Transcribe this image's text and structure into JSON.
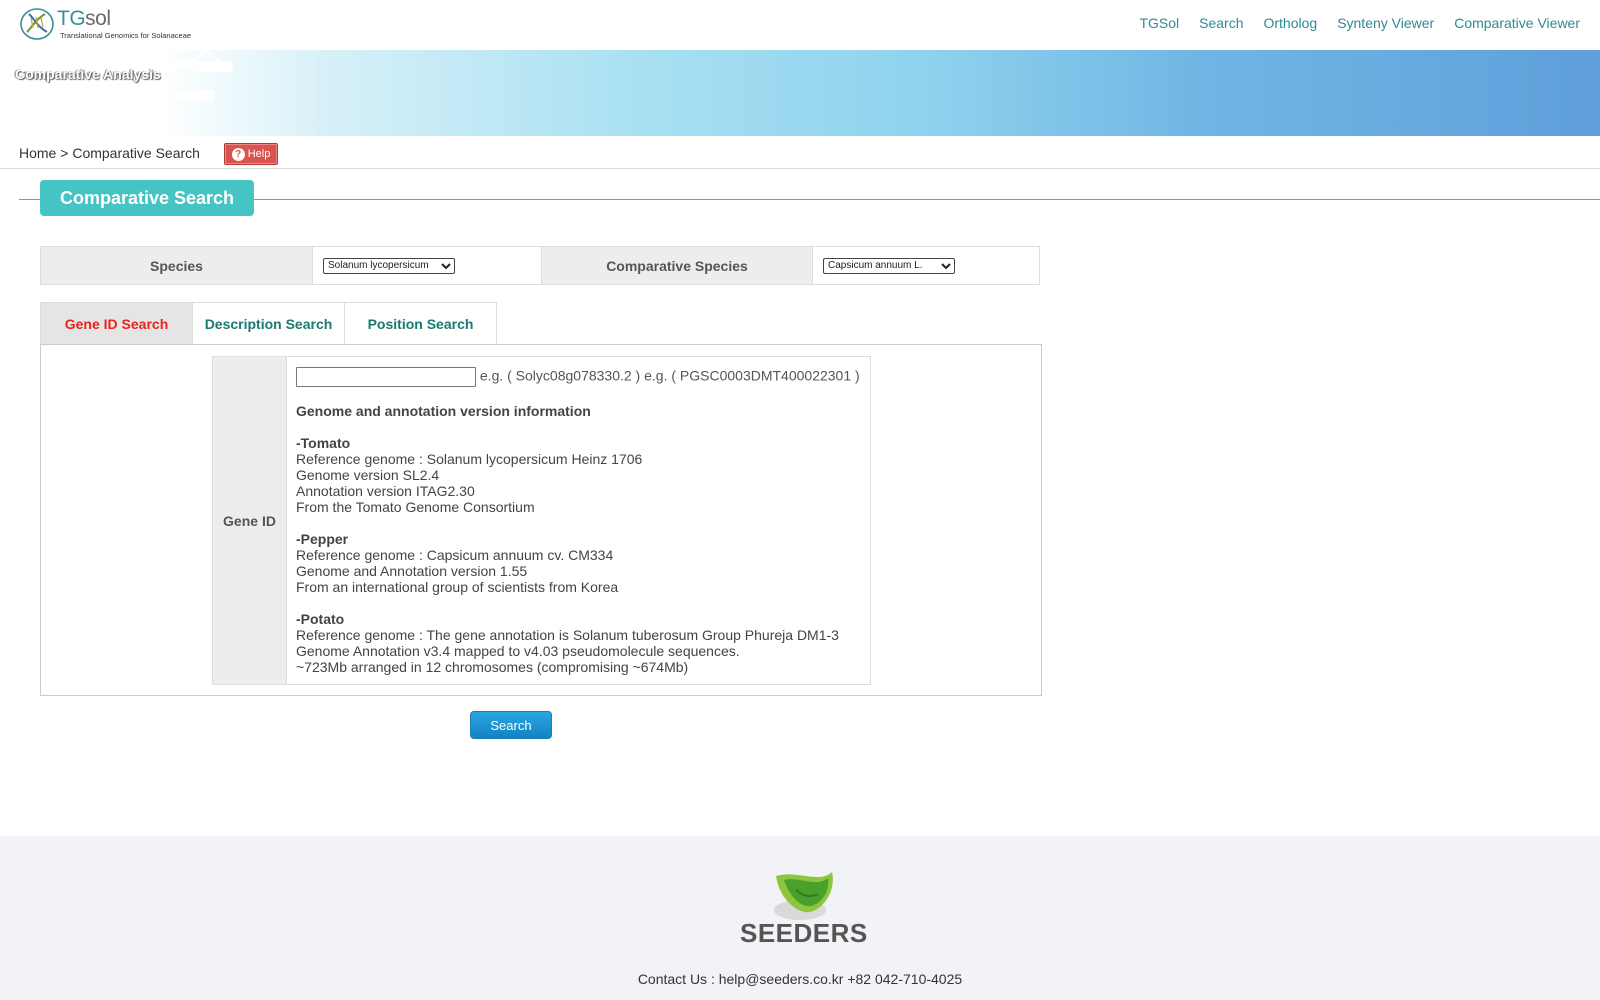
{
  "header": {
    "logo_title_pre": "TG",
    "logo_title_post": "sol",
    "logo_subtitle": "Translational Genomics for Solanaceae",
    "nav": [
      "TGSol",
      "Search",
      "Ortholog",
      "Synteny Viewer",
      "Comparative Viewer"
    ]
  },
  "banner": {
    "title": "Comparative Analysis"
  },
  "breadcrumb": {
    "home": "Home",
    "sep": ">",
    "current": "Comparative Search",
    "help_label": "Help"
  },
  "section": {
    "title": "Comparative Search"
  },
  "species": {
    "label": "Species",
    "selected": "Solanum lycopersicum",
    "comparative_label": "Comparative Species",
    "comparative_selected": "Capsicum annuum L."
  },
  "tabs": [
    {
      "label": "Gene ID Search",
      "active": true
    },
    {
      "label": "Description Search",
      "active": false
    },
    {
      "label": "Position Search",
      "active": false
    }
  ],
  "gene_search": {
    "label": "Gene ID",
    "input_value": "",
    "example": "e.g. ( Solyc08g078330.2 ) e.g. ( PGSC0003DMT400022301 )",
    "info_heading": "Genome and annotation version information",
    "tomato": {
      "heading": "-Tomato",
      "lines": [
        "Reference genome : Solanum lycopersicum Heinz 1706",
        "Genome version SL2.4",
        "Annotation version ITAG2.30",
        "From the Tomato Genome Consortium"
      ]
    },
    "pepper": {
      "heading": "-Pepper",
      "lines": [
        "Reference genome : Capsicum annuum cv. CM334",
        "Genome and Annotation version 1.55",
        "From an international group of scientists from Korea"
      ]
    },
    "potato": {
      "heading": "-Potato",
      "lines": [
        "Reference genome : The gene annotation is Solanum tuberosum Group Phureja DM1-3",
        "Genome Annotation v3.4 mapped to v4.03 pseudomolecule sequences.",
        "~723Mb arranged in 12 chromosomes (compromising ~674Mb)"
      ]
    },
    "search_button": "Search"
  },
  "footer": {
    "brand": "SEEDERS",
    "contact": "Contact Us : help@seeders.co.kr +82 042-710-4025"
  }
}
